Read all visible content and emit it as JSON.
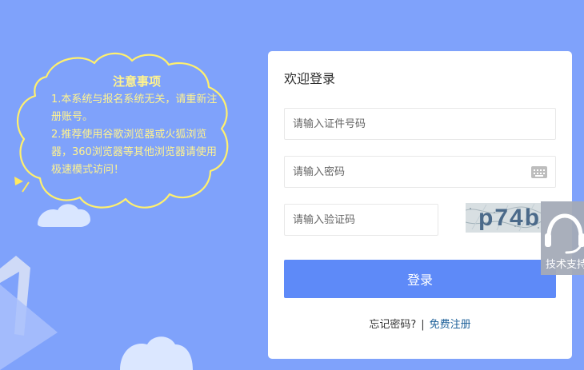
{
  "notice": {
    "title": "注意事项",
    "line1": "1.本系统与报名系统无关，请重新注册账号。",
    "line2": "2.推荐使用谷歌浏览器或火狐浏览器，360浏览器等其他浏览器请使用极速模式访问！"
  },
  "login": {
    "title": "欢迎登录",
    "id_placeholder": "请输入证件号码",
    "password_placeholder": "请输入密码",
    "captcha_placeholder": "请输入验证码",
    "captcha_text": "p74b",
    "button_label": "登录",
    "forgot_label": "忘记密码?",
    "separator": "|",
    "register_label": "免费注册"
  },
  "support": {
    "label": "技术支持"
  },
  "icons": {
    "keyboard": "keyboard-icon",
    "support": "headset-icon"
  },
  "colors": {
    "background": "#7fa2fb",
    "notice_text": "#fff38f",
    "primary_button": "#5e8af8",
    "register_link": "#1b5f99"
  }
}
